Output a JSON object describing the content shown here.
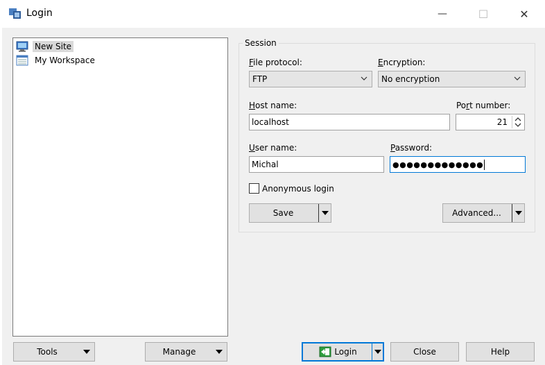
{
  "window": {
    "title": "Login",
    "minimize_glyph": "—",
    "maximize_glyph": "☐",
    "close_glyph": "✕"
  },
  "tree": {
    "items": [
      {
        "label": "New Site",
        "icon": "monitor-icon",
        "selected": true
      },
      {
        "label": "My Workspace",
        "icon": "workspace-icon",
        "selected": false
      }
    ]
  },
  "session": {
    "group_title": "Session",
    "file_protocol": {
      "label_u": "F",
      "label_rest": "ile protocol:",
      "value": "FTP"
    },
    "encryption": {
      "label_u": "E",
      "label_rest": "ncryption:",
      "value": "No encryption"
    },
    "host_name": {
      "label_u": "H",
      "label_rest": "ost name:",
      "value": "localhost"
    },
    "port_number": {
      "label_pre": "Po",
      "label_u": "r",
      "label_rest": "t number:",
      "value": "21"
    },
    "user_name": {
      "label_u": "U",
      "label_rest": "ser name:",
      "value": "Michal"
    },
    "password": {
      "label_u": "P",
      "label_rest": "assword:",
      "value": "●●●●●●●●●●●●●"
    },
    "anonymous": {
      "label": "Anonymous login",
      "checked": false
    },
    "save_label": "Save",
    "advanced_label": "Advanced..."
  },
  "bottom": {
    "tools_label": "Tools",
    "manage_label": "Manage",
    "login_label": "Login",
    "close_label": "Close",
    "help_label": "Help"
  },
  "colors": {
    "accent": "#0078d7",
    "background": "#f0f0f0",
    "button": "#e1e1e1"
  }
}
